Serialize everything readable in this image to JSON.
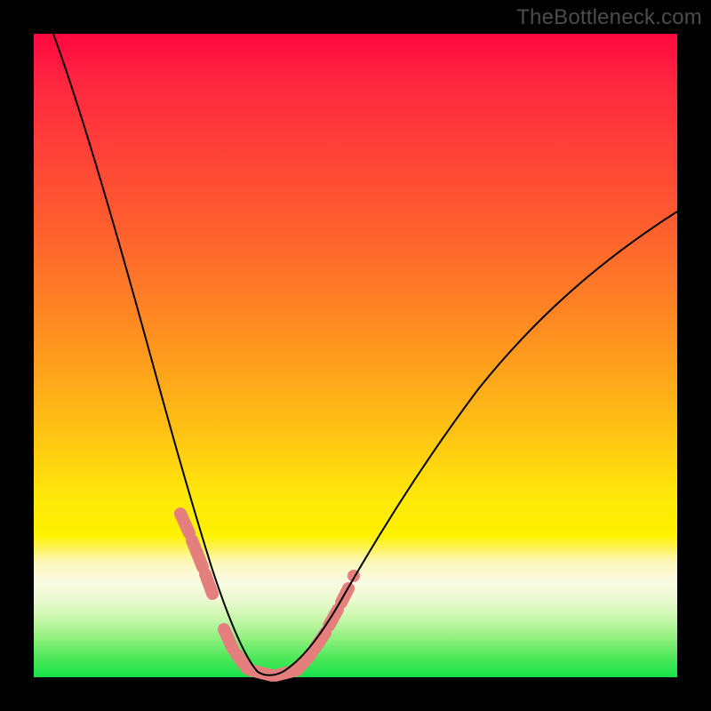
{
  "watermark": "TheBottleneck.com",
  "colors": {
    "frame": "#000000",
    "curve": "#000000",
    "highlight": "#e57f7d"
  },
  "chart_data": {
    "type": "line",
    "title": "",
    "xlabel": "",
    "ylabel": "",
    "xlim": [
      0,
      100
    ],
    "ylim": [
      0,
      100
    ],
    "grid": false,
    "legend": false,
    "series": [
      {
        "name": "left-branch",
        "x": [
          3,
          6,
          9,
          12,
          15,
          17,
          19,
          21,
          22.5,
          24,
          25.5,
          27,
          28.5,
          30,
          31.5,
          33,
          34.5
        ],
        "y": [
          100,
          91,
          82,
          73,
          63,
          55,
          47,
          38,
          32,
          26,
          20,
          15,
          10.5,
          6.5,
          3.5,
          1.3,
          0.2
        ]
      },
      {
        "name": "valley-floor",
        "x": [
          34.5,
          36,
          37.5
        ],
        "y": [
          0.2,
          0.0,
          0.2
        ]
      },
      {
        "name": "right-branch",
        "x": [
          37.5,
          39,
          41,
          43,
          45.5,
          48.5,
          52,
          56,
          61,
          67,
          74,
          82,
          91,
          100
        ],
        "y": [
          0.2,
          1.2,
          3.2,
          6.0,
          9.5,
          14.0,
          19.0,
          24.5,
          30.5,
          37.5,
          45.0,
          53.0,
          61.5,
          70.0
        ]
      }
    ],
    "highlight_segments": [
      {
        "branch": "left",
        "x_range": [
          22.5,
          27.0
        ]
      },
      {
        "branch": "floor",
        "x_range": [
          30.0,
          41.0
        ]
      },
      {
        "branch": "right",
        "x_range": [
          41.0,
          48.5
        ]
      }
    ]
  }
}
